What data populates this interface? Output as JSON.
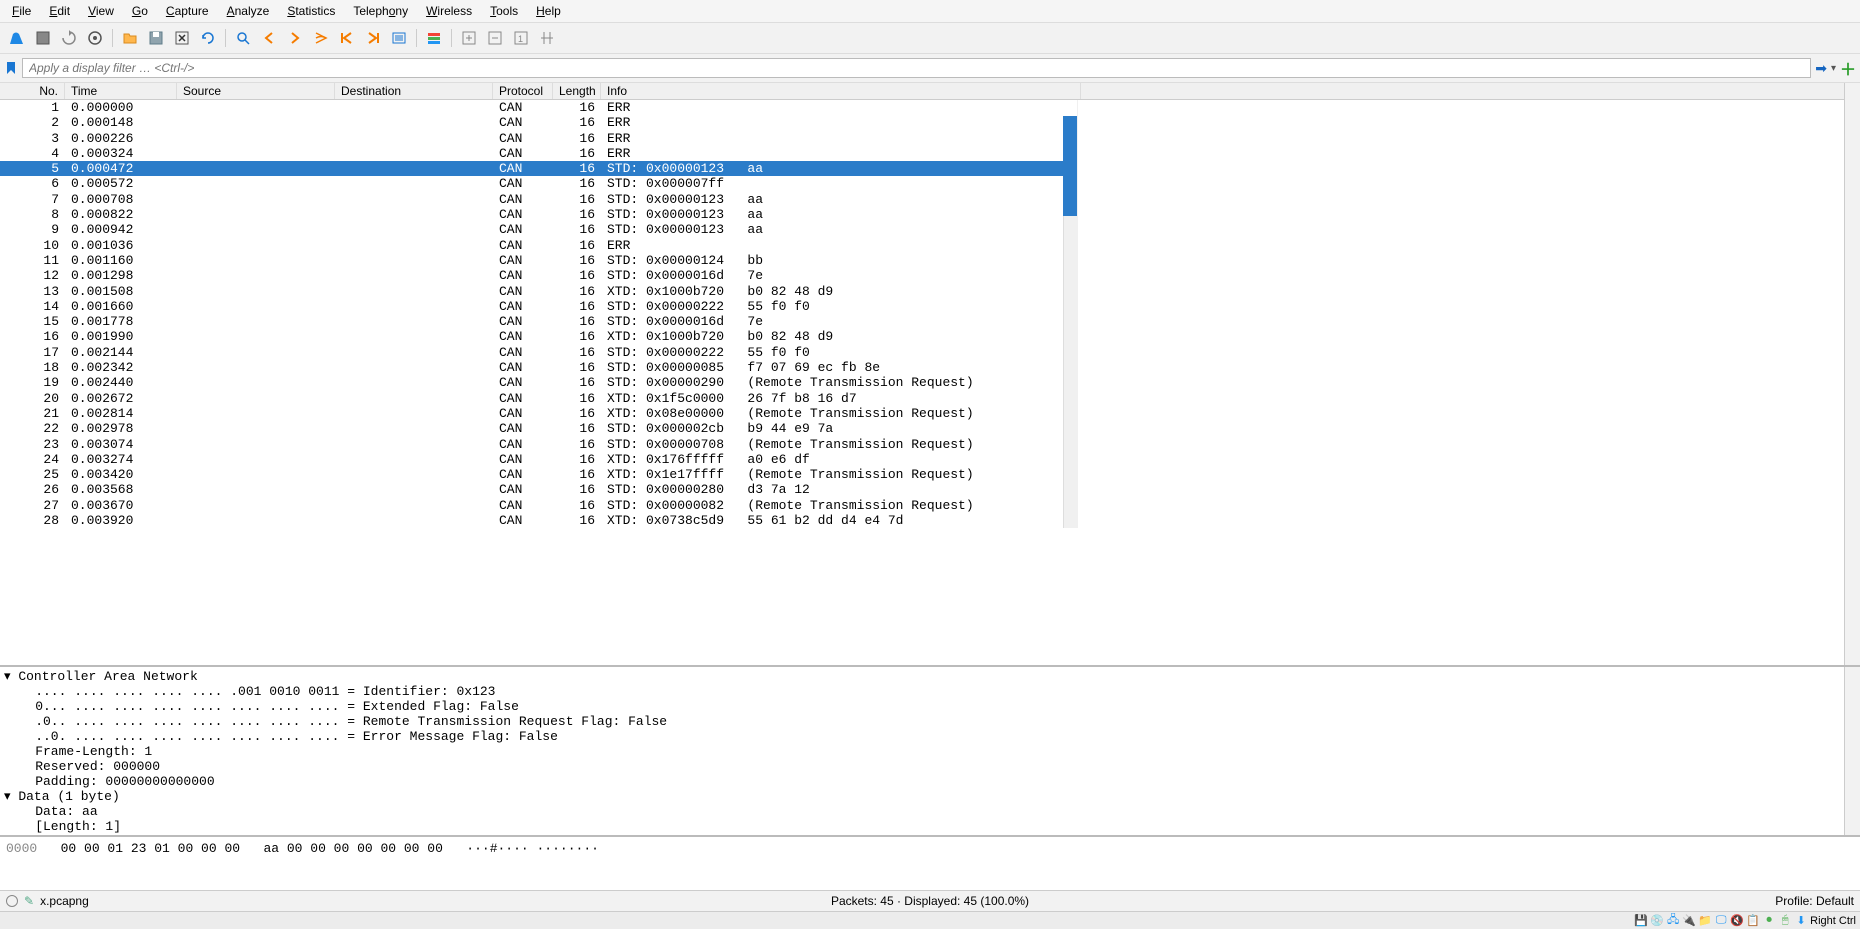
{
  "menubar": {
    "items": [
      {
        "label": "File",
        "u": 0
      },
      {
        "label": "Edit",
        "u": 0
      },
      {
        "label": "View",
        "u": 0
      },
      {
        "label": "Go",
        "u": 0
      },
      {
        "label": "Capture",
        "u": 0
      },
      {
        "label": "Analyze",
        "u": 0
      },
      {
        "label": "Statistics",
        "u": 0
      },
      {
        "label": "Telephony",
        "u": 6
      },
      {
        "label": "Wireless",
        "u": 0
      },
      {
        "label": "Tools",
        "u": 0
      },
      {
        "label": "Help",
        "u": 0
      }
    ]
  },
  "filterbar": {
    "placeholder": "Apply a display filter … <Ctrl-/>"
  },
  "packet_columns": [
    "No.",
    "Time",
    "Source",
    "Destination",
    "Protocol",
    "Length",
    "Info"
  ],
  "packet_rows": [
    {
      "no": "1",
      "time": "0.000000",
      "src": "",
      "dst": "",
      "proto": "CAN",
      "len": "16",
      "info": "ERR"
    },
    {
      "no": "2",
      "time": "0.000148",
      "src": "",
      "dst": "",
      "proto": "CAN",
      "len": "16",
      "info": "ERR"
    },
    {
      "no": "3",
      "time": "0.000226",
      "src": "",
      "dst": "",
      "proto": "CAN",
      "len": "16",
      "info": "ERR"
    },
    {
      "no": "4",
      "time": "0.000324",
      "src": "",
      "dst": "",
      "proto": "CAN",
      "len": "16",
      "info": "ERR"
    },
    {
      "no": "5",
      "time": "0.000472",
      "src": "",
      "dst": "",
      "proto": "CAN",
      "len": "16",
      "info": "STD: 0x00000123   aa",
      "selected": true
    },
    {
      "no": "6",
      "time": "0.000572",
      "src": "",
      "dst": "",
      "proto": "CAN",
      "len": "16",
      "info": "STD: 0x000007ff"
    },
    {
      "no": "7",
      "time": "0.000708",
      "src": "",
      "dst": "",
      "proto": "CAN",
      "len": "16",
      "info": "STD: 0x00000123   aa"
    },
    {
      "no": "8",
      "time": "0.000822",
      "src": "",
      "dst": "",
      "proto": "CAN",
      "len": "16",
      "info": "STD: 0x00000123   aa"
    },
    {
      "no": "9",
      "time": "0.000942",
      "src": "",
      "dst": "",
      "proto": "CAN",
      "len": "16",
      "info": "STD: 0x00000123   aa"
    },
    {
      "no": "10",
      "time": "0.001036",
      "src": "",
      "dst": "",
      "proto": "CAN",
      "len": "16",
      "info": "ERR"
    },
    {
      "no": "11",
      "time": "0.001160",
      "src": "",
      "dst": "",
      "proto": "CAN",
      "len": "16",
      "info": "STD: 0x00000124   bb"
    },
    {
      "no": "12",
      "time": "0.001298",
      "src": "",
      "dst": "",
      "proto": "CAN",
      "len": "16",
      "info": "STD: 0x0000016d   7e"
    },
    {
      "no": "13",
      "time": "0.001508",
      "src": "",
      "dst": "",
      "proto": "CAN",
      "len": "16",
      "info": "XTD: 0x1000b720   b0 82 48 d9"
    },
    {
      "no": "14",
      "time": "0.001660",
      "src": "",
      "dst": "",
      "proto": "CAN",
      "len": "16",
      "info": "STD: 0x00000222   55 f0 f0"
    },
    {
      "no": "15",
      "time": "0.001778",
      "src": "",
      "dst": "",
      "proto": "CAN",
      "len": "16",
      "info": "STD: 0x0000016d   7e"
    },
    {
      "no": "16",
      "time": "0.001990",
      "src": "",
      "dst": "",
      "proto": "CAN",
      "len": "16",
      "info": "XTD: 0x1000b720   b0 82 48 d9"
    },
    {
      "no": "17",
      "time": "0.002144",
      "src": "",
      "dst": "",
      "proto": "CAN",
      "len": "16",
      "info": "STD: 0x00000222   55 f0 f0"
    },
    {
      "no": "18",
      "time": "0.002342",
      "src": "",
      "dst": "",
      "proto": "CAN",
      "len": "16",
      "info": "STD: 0x00000085   f7 07 69 ec fb 8e"
    },
    {
      "no": "19",
      "time": "0.002440",
      "src": "",
      "dst": "",
      "proto": "CAN",
      "len": "16",
      "info": "STD: 0x00000290   (Remote Transmission Request)"
    },
    {
      "no": "20",
      "time": "0.002672",
      "src": "",
      "dst": "",
      "proto": "CAN",
      "len": "16",
      "info": "XTD: 0x1f5c0000   26 7f b8 16 d7"
    },
    {
      "no": "21",
      "time": "0.002814",
      "src": "",
      "dst": "",
      "proto": "CAN",
      "len": "16",
      "info": "XTD: 0x08e00000   (Remote Transmission Request)"
    },
    {
      "no": "22",
      "time": "0.002978",
      "src": "",
      "dst": "",
      "proto": "CAN",
      "len": "16",
      "info": "STD: 0x000002cb   b9 44 e9 7a"
    },
    {
      "no": "23",
      "time": "0.003074",
      "src": "",
      "dst": "",
      "proto": "CAN",
      "len": "16",
      "info": "STD: 0x00000708   (Remote Transmission Request)"
    },
    {
      "no": "24",
      "time": "0.003274",
      "src": "",
      "dst": "",
      "proto": "CAN",
      "len": "16",
      "info": "XTD: 0x176fffff   a0 e6 df"
    },
    {
      "no": "25",
      "time": "0.003420",
      "src": "",
      "dst": "",
      "proto": "CAN",
      "len": "16",
      "info": "XTD: 0x1e17ffff   (Remote Transmission Request)"
    },
    {
      "no": "26",
      "time": "0.003568",
      "src": "",
      "dst": "",
      "proto": "CAN",
      "len": "16",
      "info": "STD: 0x00000280   d3 7a 12"
    },
    {
      "no": "27",
      "time": "0.003670",
      "src": "",
      "dst": "",
      "proto": "CAN",
      "len": "16",
      "info": "STD: 0x00000082   (Remote Transmission Request)"
    },
    {
      "no": "28",
      "time": "0.003920",
      "src": "",
      "dst": "",
      "proto": "CAN",
      "len": "16",
      "info": "XTD: 0x0738c5d9   55 61 b2 dd d4 e4 7d"
    }
  ],
  "details": [
    {
      "indent": 0,
      "exp": "▾",
      "text": "Controller Area Network"
    },
    {
      "indent": 1,
      "exp": "",
      "text": ".... .... .... .... .... .001 0010 0011 = Identifier: 0x123"
    },
    {
      "indent": 1,
      "exp": "",
      "text": "0... .... .... .... .... .... .... .... = Extended Flag: False"
    },
    {
      "indent": 1,
      "exp": "",
      "text": ".0.. .... .... .... .... .... .... .... = Remote Transmission Request Flag: False"
    },
    {
      "indent": 1,
      "exp": "",
      "text": "..0. .... .... .... .... .... .... .... = Error Message Flag: False"
    },
    {
      "indent": 1,
      "exp": "",
      "text": "Frame-Length: 1"
    },
    {
      "indent": 1,
      "exp": "",
      "text": "Reserved: 000000"
    },
    {
      "indent": 1,
      "exp": "",
      "text": "Padding: 00000000000000"
    },
    {
      "indent": 0,
      "exp": "▾",
      "text": "Data (1 byte)"
    },
    {
      "indent": 1,
      "exp": "",
      "text": "Data: aa"
    },
    {
      "indent": 1,
      "exp": "",
      "text": "[Length: 1]"
    }
  ],
  "hex": {
    "offset": "0000",
    "bytes": "00 00 01 23 01 00 00 00   aa 00 00 00 00 00 00 00",
    "ascii": "···#···· ········"
  },
  "statusbar": {
    "file": "x.pcapng",
    "packets": "Packets: 45 · Displayed: 45 (100.0%)",
    "profile": "Profile: Default"
  },
  "vmbar": {
    "ctrl": "Right Ctrl"
  }
}
